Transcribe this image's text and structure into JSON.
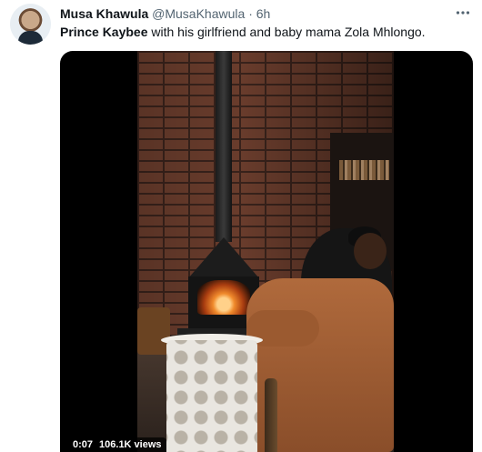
{
  "tweet": {
    "author_name": "Musa Khawula",
    "author_handle": "@MusaKhawula",
    "separator": "·",
    "time": "6h",
    "menu_icon": "more-dots-icon",
    "text_link": "Prince Kaybee",
    "text_rest": " with his girlfriend and baby mama Zola Mhlongo."
  },
  "video": {
    "timestamp": "0:07",
    "views": "106.1K views"
  },
  "colors": {
    "text_primary": "#0f1419",
    "text_secondary": "#536471",
    "background": "#ffffff"
  }
}
